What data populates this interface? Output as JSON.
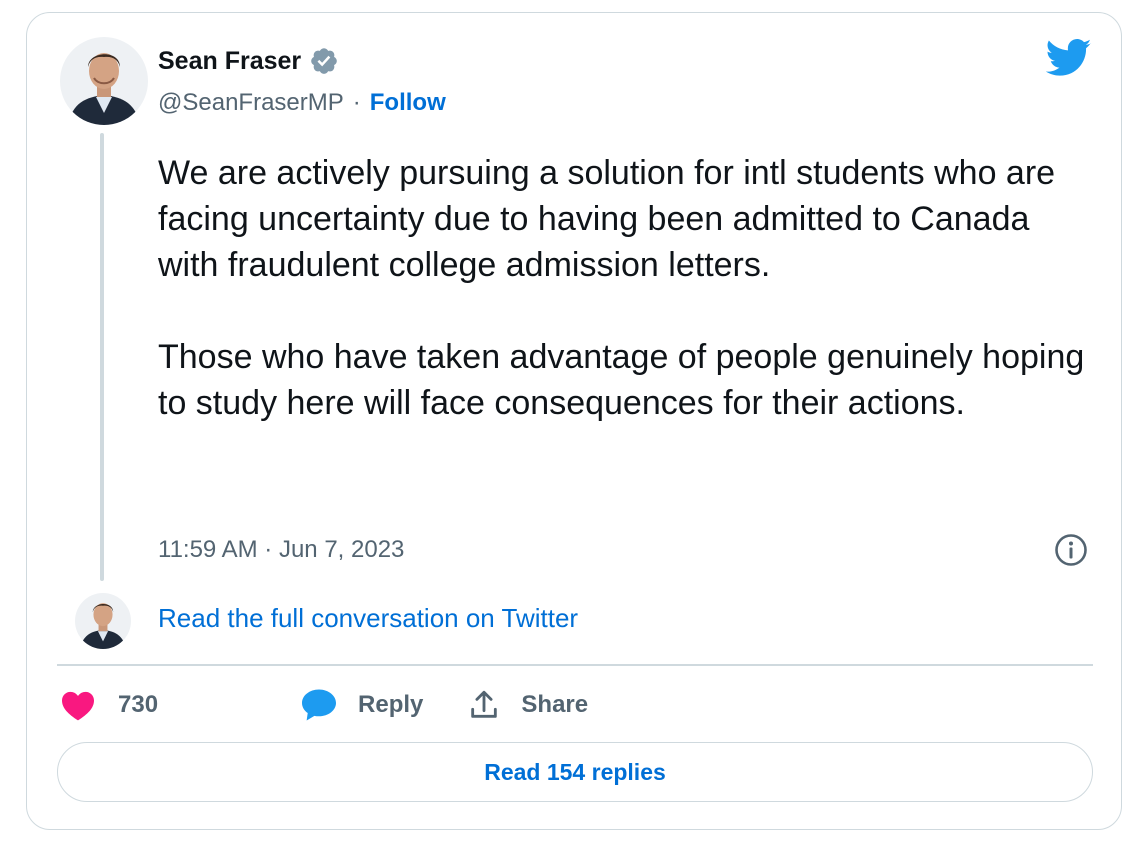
{
  "author": {
    "name": "Sean Fraser",
    "handle": "@SeanFraserMP",
    "separator": "·",
    "follow_label": "Follow"
  },
  "tweet": {
    "text": "We are actively pursuing a solution for intl students who are facing uncertainty due to having been admitted to Canada with fraudulent college admission letters.\n\nThose who have taken advantage of people genuinely hoping to study here will face consequences for their actions.",
    "timestamp": "11:59 AM · Jun 7, 2023"
  },
  "conversation_link": "Read the full conversation on Twitter",
  "actions": {
    "likes": "730",
    "reply_label": "Reply",
    "share_label": "Share"
  },
  "read_replies_label": "Read 154 replies",
  "icons": {
    "verified": "verified-badge-icon",
    "logo": "twitter-bird-icon",
    "info": "info-icon",
    "like": "heart-icon",
    "reply": "speech-bubble-icon",
    "share": "share-upload-icon"
  },
  "colors": {
    "link": "#006fd6",
    "twitter_blue": "#1d9bf0",
    "like": "#f91880",
    "verified": "#829aab",
    "secondary_text": "#536471",
    "border": "#cfd9de"
  }
}
